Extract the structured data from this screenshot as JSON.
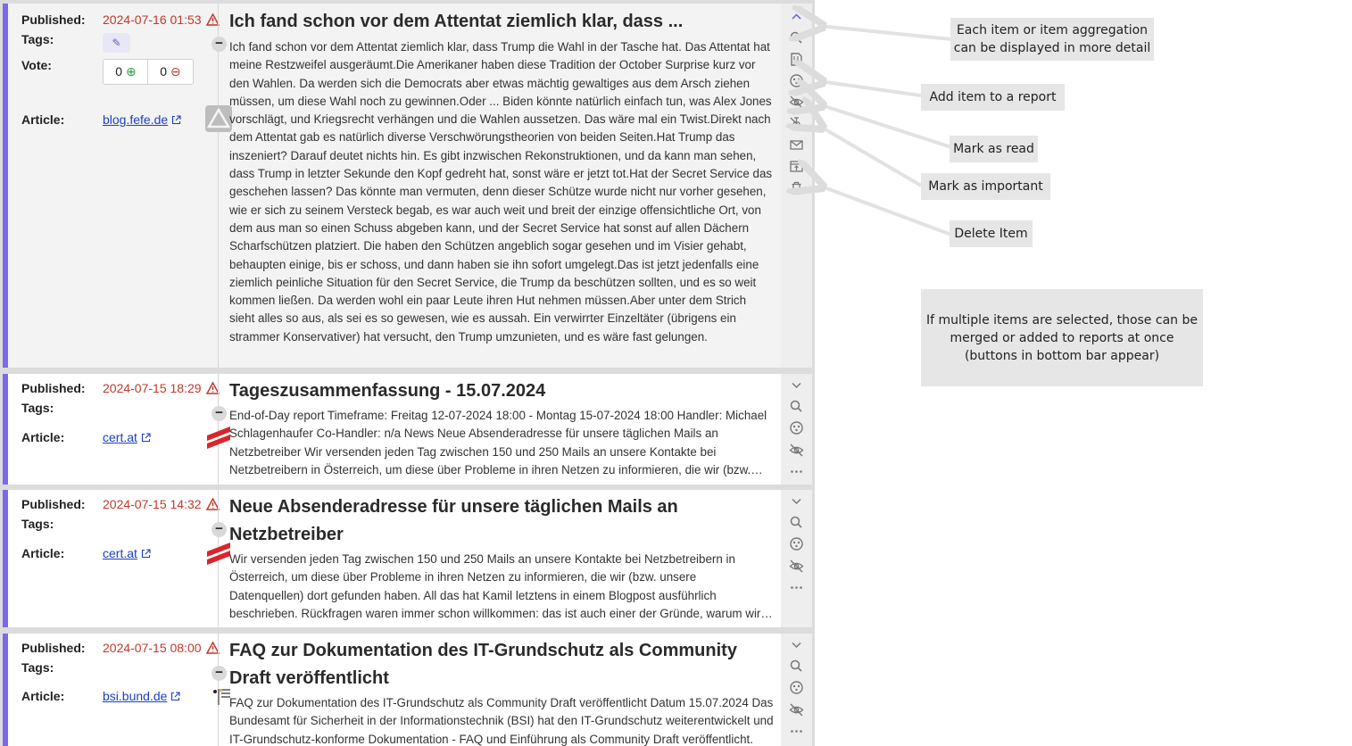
{
  "labels": {
    "published": "Published:",
    "tags": "Tags:",
    "vote": "Vote:",
    "article": "Article:"
  },
  "items": [
    {
      "published": "2024-07-16 01:53",
      "votes_up": "0",
      "votes_down": "0",
      "article": "blog.fefe.de",
      "title": "Ich fand schon vor dem Attentat ziemlich klar, dass ...",
      "body": "Ich fand schon vor dem Attentat ziemlich klar, dass Trump die Wahl in der Tasche hat. Das Attentat hat meine Restzweifel ausgeräumt.Die Amerikaner haben diese Tradition der October Surprise kurz vor den Wahlen. Da werden sich die Democrats aber etwas mächtig gewaltiges aus dem Arsch ziehen müssen, um diese Wahl noch zu gewinnen.Oder ... Biden könnte natürlich einfach tun, was Alex Jones vorschlägt, und Kriegsrecht verhängen und die Wahlen aussetzen. Das wäre mal ein Twist.Direkt nach dem Attentat gab es natürlich diverse Verschwörungstheorien von beiden Seiten.Hat Trump das inszeniert? Darauf deutet nichts hin. Es gibt inzwischen Rekonstruktionen, und da kann man sehen, dass Trump in letzter Sekunde den Kopf gedreht hat, sonst wäre er jetzt tot.Hat der Secret Service das geschehen lassen? Das könnte man vermuten, denn dieser Schütze wurde nicht nur vorher gesehen, wie er sich zu seinem Versteck begab, es war auch weit und breit der einzige offensichtliche Ort, von dem aus man so einen Schuss abgeben kann, und der Secret Service hat sonst auf allen Dächern Scharfschützen platziert. Die haben den Schützen angeblich sogar gesehen und im Visier gehabt, behaupten einige, bis er schoss, und dann haben sie ihn sofort umgelegt.Das ist jetzt jedenfalls eine ziemlich peinliche Situation für den Secret Service, die Trump da beschützen sollten, und es so weit kommen ließen. Da werden wohl ein paar Leute ihren Hut nehmen müssen.Aber unter dem Strich sieht alles so aus, als sei es so gewesen, wie es aussah. Ein verwirrter Einzeltäter (übrigens ein strammer Konservativer) hat versucht, den Trump umzunieten, und es wäre fast gelungen."
    },
    {
      "published": "2024-07-15 18:29",
      "article": "cert.at",
      "title": "Tageszusammenfassung - 15.07.2024",
      "body": "End-of-Day report Timeframe: Freitag 12-07-2024 18:00 - Montag 15-07-2024 18:00 Handler: Michael Schlagenhaufer Co-Handler: n/a News Neue Absenderadresse für unsere täglichen Mails an Netzbetreiber Wir versenden jeden Tag zwischen 150 und 250 Mails an unsere Kontakte bei Netzbetreibern in Österreich, um diese über Probleme in ihren Netzen zu informieren, die wir (bzw. unsere Datenquellen) dort gefunden haben."
    },
    {
      "published": "2024-07-15 14:32",
      "article": "cert.at",
      "title": "Neue Absenderadresse für unsere täglichen Mails an Netzbetreiber",
      "body": "Wir versenden jeden Tag zwischen 150 und 250 Mails an unsere Kontakte bei Netzbetreibern in Österreich, um diese über Probleme in ihren Netzen zu informieren, die wir (bzw. unsere Datenquellen) dort gefunden haben. All das hat Kamil letztens in einem Blogpost ausführlich beschrieben. Rückfragen waren immer schon willkommen: das ist auch einer der Gründe, warum wir das so machen."
    },
    {
      "published": "2024-07-15 08:00",
      "article": "bsi.bund.de",
      "title": "FAQ zur Dokumentation des IT-Grundschutz als Community Draft veröffentlicht",
      "body": "FAQ zur Dokumentation des IT-Grundschutz als Community Draft veröffentlicht Datum 15.07.2024 Das Bundesamt für Sicherheit in der Informationstechnik (BSI) hat den IT-Grundschutz weiterentwickelt und IT-Grundschutz-konforme Dokumentation - FAQ und Einführung als Community Draft veröffentlicht."
    }
  ],
  "annotations": {
    "detail": "Each item or item aggregation can be displayed in more detail",
    "report": "Add item to a report",
    "read": "Mark as read",
    "important": "Mark as important",
    "delete": "Delete Item",
    "multi": "If multiple items are selected, those can be merged or added to reports at once (buttons in bottom bar appear)"
  },
  "colors": {
    "accent": "#7b68ee",
    "date": "#c0392b",
    "link": "#1a3fc4",
    "annotation_bg": "#e6e6e6"
  },
  "icons": {
    "actions_full": [
      "chevron-up-icon",
      "search-icon",
      "report-add-icon",
      "share-icon",
      "eye-off-icon",
      "unpin-icon",
      "mail-icon",
      "move-icon",
      "delete-icon"
    ],
    "actions_compact": [
      "chevron-down-icon",
      "search-icon",
      "share-icon",
      "eye-off-icon",
      "more-icon"
    ]
  }
}
